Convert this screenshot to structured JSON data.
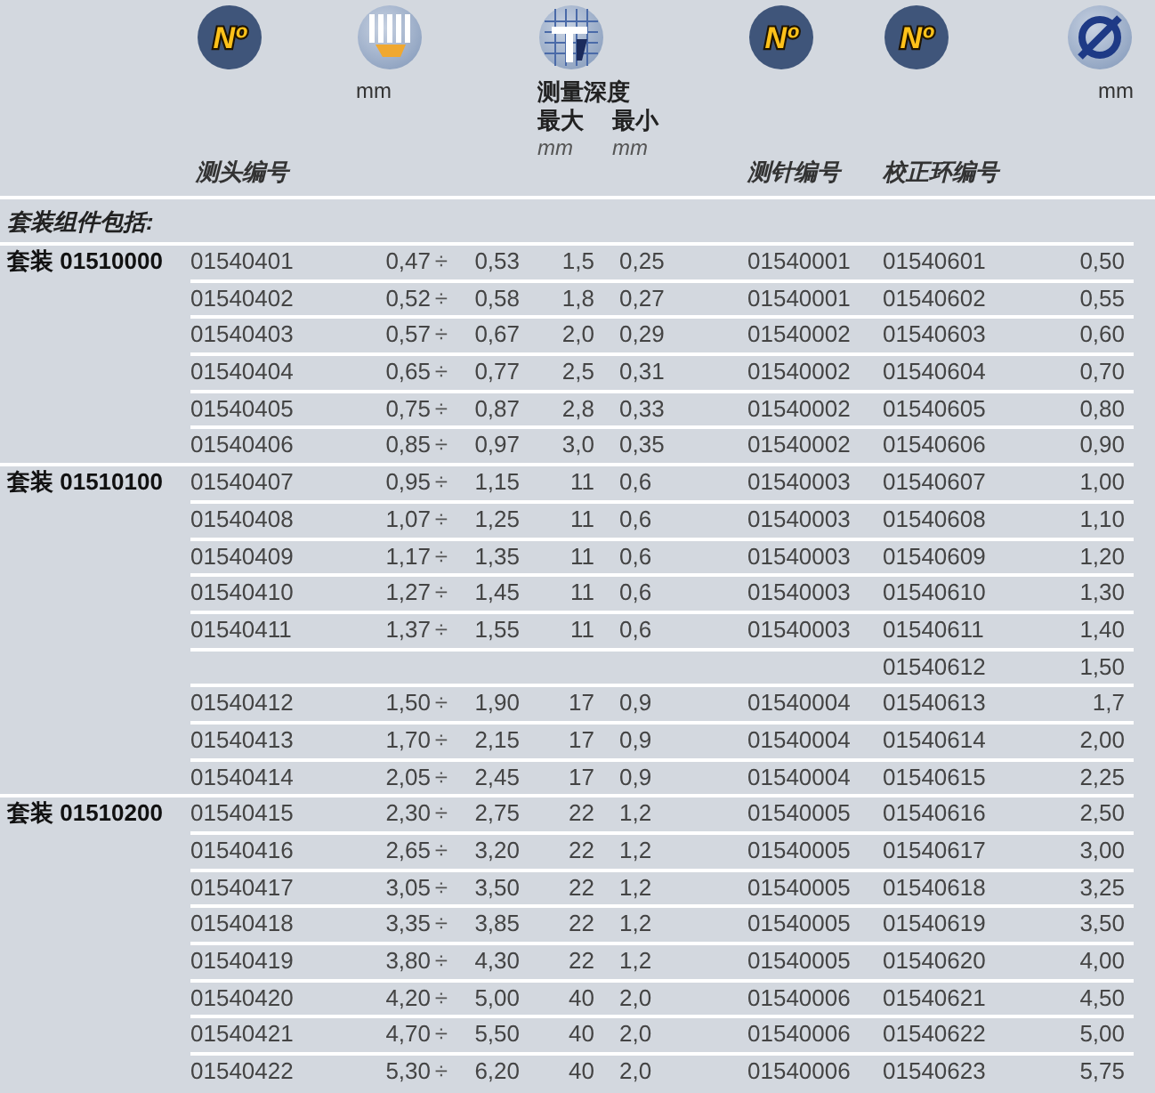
{
  "columns": [
    {
      "kind": "numero",
      "badge": "Nº",
      "label": "测头编号"
    },
    {
      "kind": "gauge",
      "unit": "mm"
    },
    {
      "kind": "depth",
      "title": "测量深度",
      "sub": [
        {
          "label": "最大",
          "unit": "mm"
        },
        {
          "label": "最小",
          "unit": "mm"
        }
      ]
    },
    {
      "kind": "numero",
      "badge": "Nº",
      "label": "测针编号"
    },
    {
      "kind": "numero",
      "badge": "Nº",
      "label": "校正环编号"
    },
    {
      "kind": "diameter",
      "unit": "mm"
    }
  ],
  "section_title": "套装组件包括:",
  "rows": [
    {
      "group": "套装 01510000",
      "head": "01540401",
      "range_from": "0,47",
      "sep": "÷",
      "range_to": "0,53",
      "depth_max": "1,5",
      "depth_min": "0,25",
      "pin": "01540001",
      "ring": "01540601",
      "diameter": "0,50"
    },
    {
      "head": "01540402",
      "range_from": "0,52",
      "sep": "÷",
      "range_to": "0,58",
      "depth_max": "1,8",
      "depth_min": "0,27",
      "pin": "01540001",
      "ring": "01540602",
      "diameter": "0,55"
    },
    {
      "head": "01540403",
      "range_from": "0,57",
      "sep": "÷",
      "range_to": "0,67",
      "depth_max": "2,0",
      "depth_min": "0,29",
      "pin": "01540002",
      "ring": "01540603",
      "diameter": "0,60"
    },
    {
      "head": "01540404",
      "range_from": "0,65",
      "sep": "÷",
      "range_to": "0,77",
      "depth_max": "2,5",
      "depth_min": "0,31",
      "pin": "01540002",
      "ring": "01540604",
      "diameter": "0,70"
    },
    {
      "head": "01540405",
      "range_from": "0,75",
      "sep": "÷",
      "range_to": "0,87",
      "depth_max": "2,8",
      "depth_min": "0,33",
      "pin": "01540002",
      "ring": "01540605",
      "diameter": "0,80"
    },
    {
      "head": "01540406",
      "range_from": "0,85",
      "sep": "÷",
      "range_to": "0,97",
      "depth_max": "3,0",
      "depth_min": "0,35",
      "pin": "01540002",
      "ring": "01540606",
      "diameter": "0,90"
    },
    {
      "group": "套装 01510100",
      "head": "01540407",
      "range_from": "0,95",
      "sep": "÷",
      "range_to": "1,15",
      "depth_max": "11",
      "depth_min": "0,6",
      "pin": "01540003",
      "ring": "01540607",
      "diameter": "1,00"
    },
    {
      "head": "01540408",
      "range_from": "1,07",
      "sep": "÷",
      "range_to": "1,25",
      "depth_max": "11",
      "depth_min": "0,6",
      "pin": "01540003",
      "ring": "01540608",
      "diameter": "1,10"
    },
    {
      "head": "01540409",
      "range_from": "1,17",
      "sep": "÷",
      "range_to": "1,35",
      "depth_max": "11",
      "depth_min": "0,6",
      "pin": "01540003",
      "ring": "01540609",
      "diameter": "1,20"
    },
    {
      "head": "01540410",
      "range_from": "1,27",
      "sep": "÷",
      "range_to": "1,45",
      "depth_max": "11",
      "depth_min": "0,6",
      "pin": "01540003",
      "ring": "01540610",
      "diameter": "1,30"
    },
    {
      "head": "01540411",
      "range_from": "1,37",
      "sep": "÷",
      "range_to": "1,55",
      "depth_max": "11",
      "depth_min": "0,6",
      "pin": "01540003",
      "ring": "01540611",
      "diameter": "1,40"
    },
    {
      "ring": "01540612",
      "diameter": "1,50"
    },
    {
      "head": "01540412",
      "range_from": "1,50",
      "sep": "÷",
      "range_to": "1,90",
      "depth_max": "17",
      "depth_min": "0,9",
      "pin": "01540004",
      "ring": "01540613",
      "diameter": "1,7"
    },
    {
      "head": "01540413",
      "range_from": "1,70",
      "sep": "÷",
      "range_to": "2,15",
      "depth_max": "17",
      "depth_min": "0,9",
      "pin": "01540004",
      "ring": "01540614",
      "diameter": "2,00"
    },
    {
      "head": "01540414",
      "range_from": "2,05",
      "sep": "÷",
      "range_to": "2,45",
      "depth_max": "17",
      "depth_min": "0,9",
      "pin": "01540004",
      "ring": "01540615",
      "diameter": "2,25"
    },
    {
      "group": "套装 01510200",
      "head": "01540415",
      "range_from": "2,30",
      "sep": "÷",
      "range_to": "2,75",
      "depth_max": "22",
      "depth_min": "1,2",
      "pin": "01540005",
      "ring": "01540616",
      "diameter": "2,50"
    },
    {
      "head": "01540416",
      "range_from": "2,65",
      "sep": "÷",
      "range_to": "3,20",
      "depth_max": "22",
      "depth_min": "1,2",
      "pin": "01540005",
      "ring": "01540617",
      "diameter": "3,00"
    },
    {
      "head": "01540417",
      "range_from": "3,05",
      "sep": "÷",
      "range_to": "3,50",
      "depth_max": "22",
      "depth_min": "1,2",
      "pin": "01540005",
      "ring": "01540618",
      "diameter": "3,25"
    },
    {
      "head": "01540418",
      "range_from": "3,35",
      "sep": "÷",
      "range_to": "3,85",
      "depth_max": "22",
      "depth_min": "1,2",
      "pin": "01540005",
      "ring": "01540619",
      "diameter": "3,50"
    },
    {
      "head": "01540419",
      "range_from": "3,80",
      "sep": "÷",
      "range_to": "4,30",
      "depth_max": "22",
      "depth_min": "1,2",
      "pin": "01540005",
      "ring": "01540620",
      "diameter": "4,00"
    },
    {
      "head": "01540420",
      "range_from": "4,20",
      "sep": "÷",
      "range_to": "5,00",
      "depth_max": "40",
      "depth_min": "2,0",
      "pin": "01540006",
      "ring": "01540621",
      "diameter": "4,50"
    },
    {
      "head": "01540421",
      "range_from": "4,70",
      "sep": "÷",
      "range_to": "5,50",
      "depth_max": "40",
      "depth_min": "2,0",
      "pin": "01540006",
      "ring": "01540622",
      "diameter": "5,00"
    },
    {
      "head": "01540422",
      "range_from": "5,30",
      "sep": "÷",
      "range_to": "6,20",
      "depth_max": "40",
      "depth_min": "2,0",
      "pin": "01540006",
      "ring": "01540623",
      "diameter": "5,75"
    }
  ]
}
